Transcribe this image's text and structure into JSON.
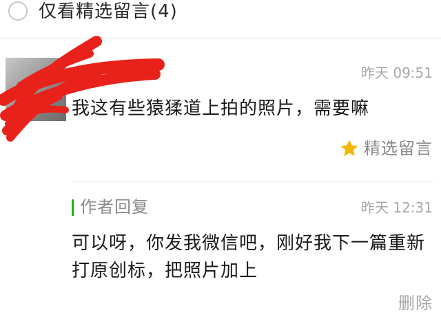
{
  "filter": {
    "label": "仅看精选留言(4)",
    "checked": false
  },
  "comment": {
    "time": "昨天 09:51",
    "text": "我这有些猿猱道上拍的照片，需要嘛",
    "featured_label": "精选留言",
    "featured_icon": "star-icon",
    "avatar_redacted": true
  },
  "reply": {
    "label": "作者回复",
    "time": "昨天 12:31",
    "text": "可以呀，你发我微信吧，刚好我下一篇重新打原创标，把照片加上",
    "delete_label": "删除"
  },
  "colors": {
    "accent_green": "#1aad19",
    "star_yellow": "#f7b500",
    "redaction_red": "#e8221b",
    "muted_text": "#8a8a8a",
    "time_text": "#a8a8a8"
  }
}
